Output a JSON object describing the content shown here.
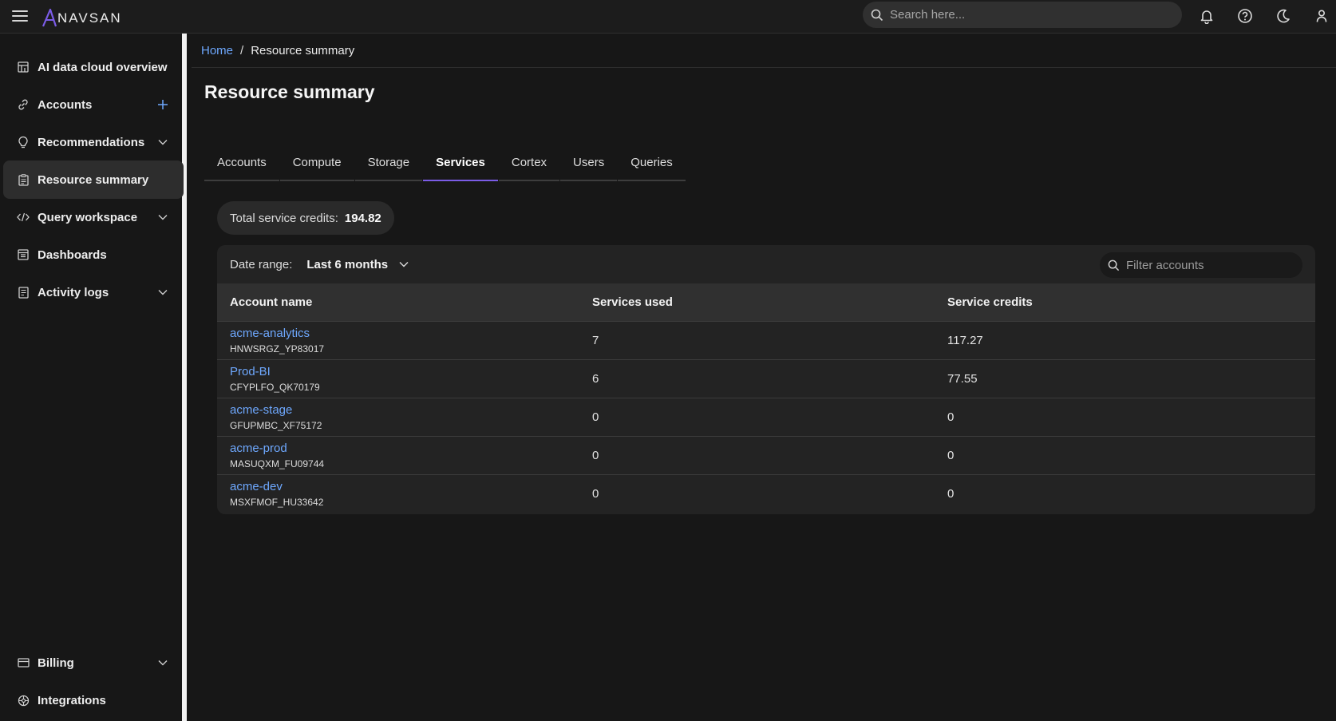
{
  "app": {
    "brand_mark": "A",
    "brand_text": "NAVSAN"
  },
  "topbar": {
    "search_placeholder": "Search here..."
  },
  "sidebar": {
    "items": [
      {
        "label": "AI data cloud overview"
      },
      {
        "label": "Accounts"
      },
      {
        "label": "Recommendations"
      },
      {
        "label": "Resource summary"
      },
      {
        "label": "Query workspace"
      },
      {
        "label": "Dashboards"
      },
      {
        "label": "Activity logs"
      },
      {
        "label": "Billing"
      },
      {
        "label": "Integrations"
      }
    ]
  },
  "breadcrumb": {
    "home": "Home",
    "separator": "/",
    "current": "Resource summary"
  },
  "page": {
    "title": "Resource summary"
  },
  "tabs": [
    "Accounts",
    "Compute",
    "Storage",
    "Services",
    "Cortex",
    "Users",
    "Queries"
  ],
  "summary": {
    "label": "Total service credits:",
    "value": "194.82"
  },
  "filters": {
    "date_range_label": "Date range:",
    "date_range_value": "Last 6 months",
    "filter_placeholder": "Filter accounts"
  },
  "table": {
    "headers": [
      "Account name",
      "Services used",
      "Service credits"
    ],
    "rows": [
      {
        "name": "acme-analytics",
        "id": "HNWSRGZ_YP83017",
        "services": "7",
        "credits": "117.27"
      },
      {
        "name": "Prod-BI",
        "id": "CFYPLFO_QK70179",
        "services": "6",
        "credits": "77.55"
      },
      {
        "name": "acme-stage",
        "id": "GFUPMBC_XF75172",
        "services": "0",
        "credits": "0"
      },
      {
        "name": "acme-prod",
        "id": "MASUQXM_FU09744",
        "services": "0",
        "credits": "0"
      },
      {
        "name": "acme-dev",
        "id": "MSXFMOF_HU33642",
        "services": "0",
        "credits": "0"
      }
    ]
  },
  "colors": {
    "accent": "#7b5ce6",
    "link": "#6ea8fe",
    "background": "#171717"
  }
}
